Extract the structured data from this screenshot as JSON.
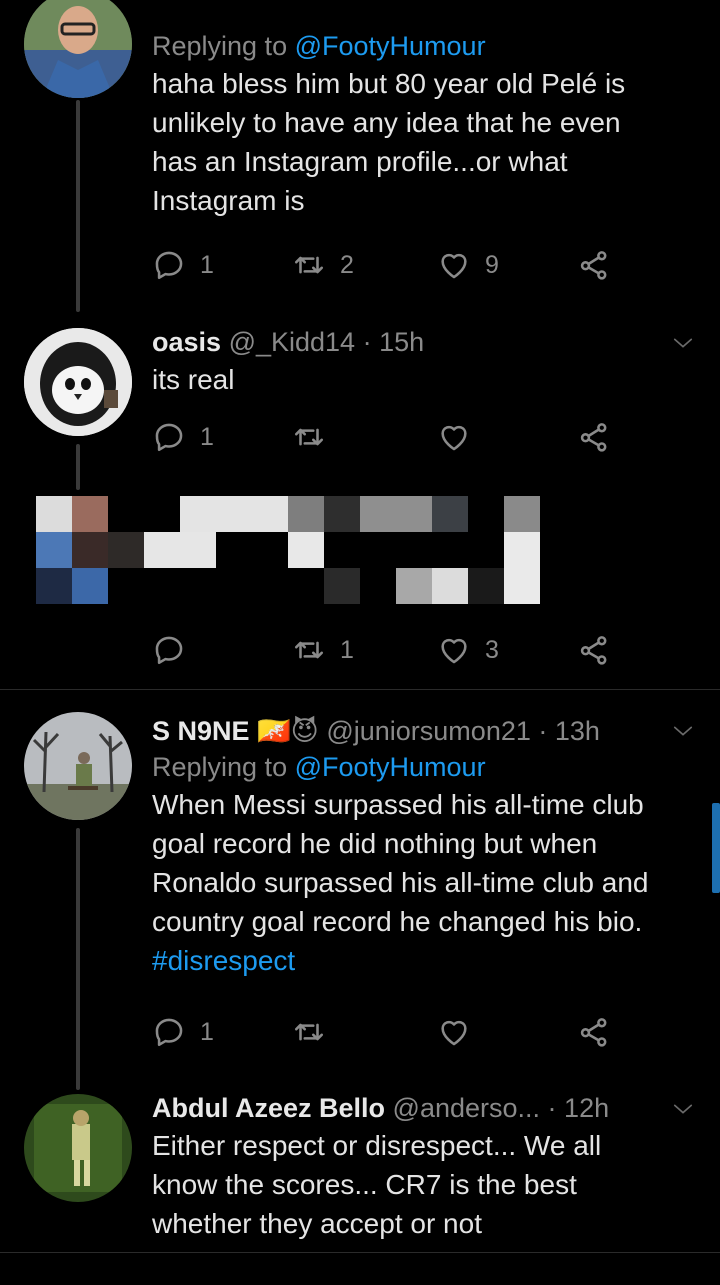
{
  "tweets": [
    {
      "reply_prefix": "Replying to ",
      "reply_handle": "@FootyHumour",
      "text_lines": [
        "haha bless him but 80 year old Pelé is",
        "unlikely to have any idea that he even",
        "has an Instagram profile...or what",
        "Instagram is"
      ],
      "replies": "1",
      "retweets": "2",
      "likes": "9"
    },
    {
      "name": "oasis",
      "handle": "@_Kidd14",
      "sep": " · ",
      "time": "15h",
      "text": "its real",
      "replies": "1",
      "retweets": "",
      "likes": ""
    },
    {
      "replies": "",
      "retweets": "1",
      "likes": "3"
    },
    {
      "name": "S N9NE",
      "emojis": "🇧🇹😈",
      "handle": "@juniorsumon21",
      "sep": " · ",
      "time": "13h",
      "reply_prefix": "Replying to ",
      "reply_handle": "@FootyHumour",
      "text_lines": [
        "When Messi surpassed his all-time club",
        "goal record he did nothing but when",
        "Ronaldo surpassed his all-time club and",
        "country goal record he changed his bio."
      ],
      "hashtag": "#disrespect",
      "replies": "1",
      "retweets": "",
      "likes": ""
    },
    {
      "name": "Abdul Azeez Bello",
      "handle": "@anderso...",
      "sep": " · ",
      "time": "12h",
      "text_lines": [
        "Either respect or disrespect... We all",
        "know the scores... CR7 is the best",
        "whether they accept or not"
      ]
    }
  ],
  "icons": {
    "reply": "reply-icon",
    "retweet": "retweet-icon",
    "like": "heart-icon",
    "share": "share-icon",
    "menu": "chevron-down-icon"
  },
  "colors": {
    "background": "#000000",
    "link": "#1d9bf0",
    "muted": "#8a8a8a",
    "text": "#e4e4e4"
  }
}
